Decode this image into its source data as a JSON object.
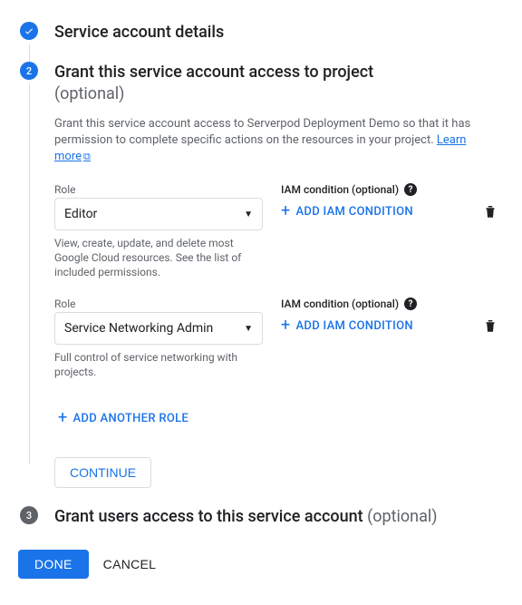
{
  "step1": {
    "title": "Service account details"
  },
  "step2": {
    "number": "2",
    "title": "Grant this service account access to project",
    "optional": "(optional)",
    "description_prefix": "Grant this service account access to Serverpod Deployment Demo so that it has permission to complete specific actions on the resources in your project. ",
    "learn_more": "Learn more",
    "roles": [
      {
        "label": "Role",
        "value": "Editor",
        "hint": "View, create, update, and delete most Google Cloud resources. See the list of included permissions.",
        "iam_label": "IAM condition (optional)",
        "add_iam": "ADD IAM CONDITION"
      },
      {
        "label": "Role",
        "value": "Service Networking Admin",
        "hint": "Full control of service networking with projects.",
        "iam_label": "IAM condition (optional)",
        "add_iam": "ADD IAM CONDITION"
      }
    ],
    "add_role": "ADD ANOTHER ROLE",
    "continue": "CONTINUE"
  },
  "step3": {
    "number": "3",
    "title": "Grant users access to this service account ",
    "optional": "(optional)"
  },
  "footer": {
    "done": "DONE",
    "cancel": "CANCEL"
  }
}
